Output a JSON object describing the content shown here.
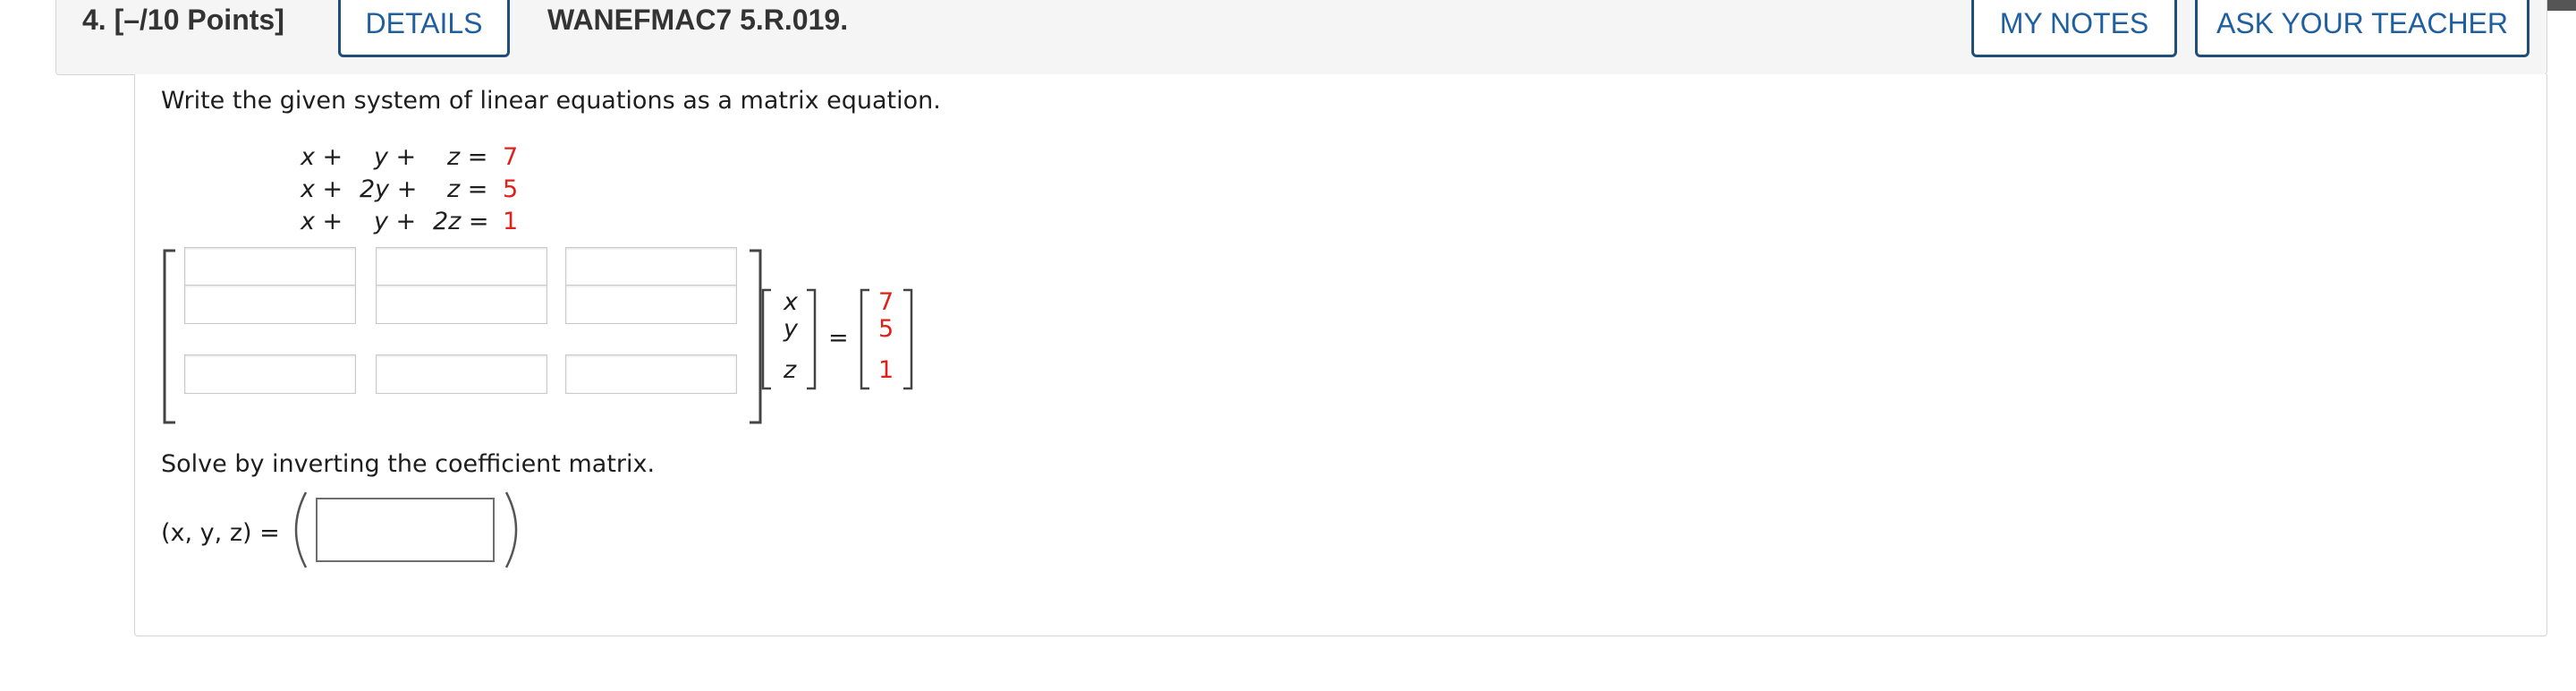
{
  "header": {
    "question_points": "4.  [–/10 Points]",
    "details_label": "DETAILS",
    "problem_code": "WANEFMAC7 5.R.019.",
    "my_notes_label": "MY NOTES",
    "ask_teacher_label": "ASK YOUR TEACHER"
  },
  "question": {
    "instruction": "Write the given system of linear equations as a matrix equation.",
    "equations": [
      {
        "c1": "x +",
        "c2": "y +",
        "c3": "z =",
        "rhs": "7"
      },
      {
        "c1": "x +",
        "c2": "2y +",
        "c3": "z =",
        "rhs": "5"
      },
      {
        "c1": "x +",
        "c2": "y +",
        "c3": "2z =",
        "rhs": "1"
      }
    ],
    "var_vector": [
      "x",
      "y",
      "z"
    ],
    "equals": "=",
    "const_vector": [
      "7",
      "5",
      "1"
    ],
    "solve_instruction": "Solve by inverting the coefficient matrix.",
    "answer_label": "(x, y, z) ="
  },
  "colors": {
    "rhs": "#e0201a",
    "button_text": "#1f5fa0",
    "button_border": "#1f4e79"
  }
}
